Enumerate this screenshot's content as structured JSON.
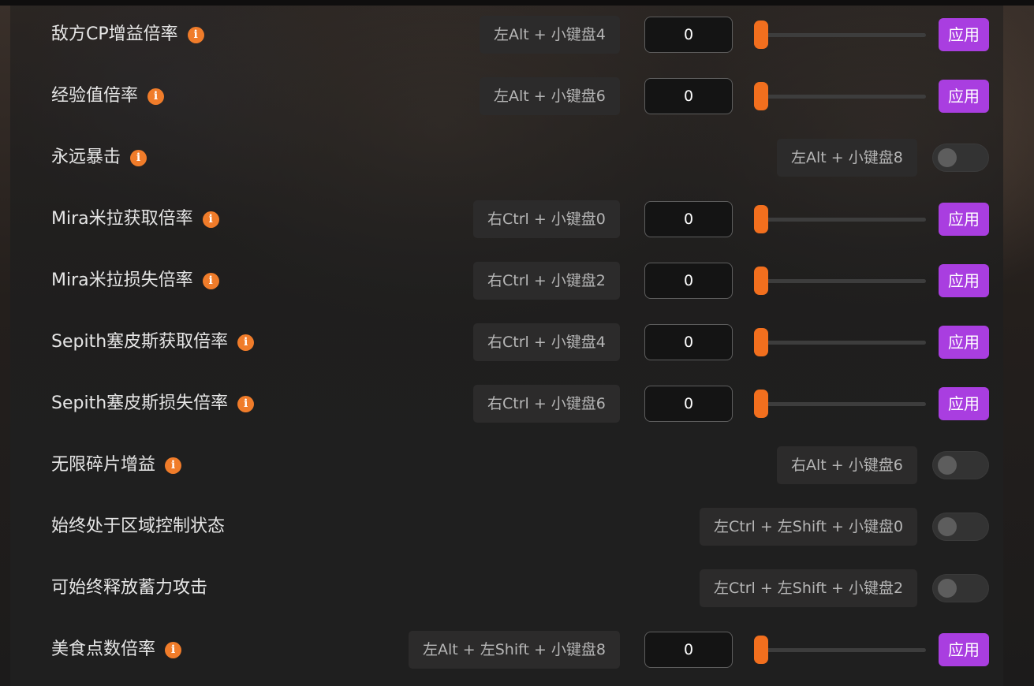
{
  "rows": [
    {
      "label": "敌方CP增益倍率",
      "info": true,
      "hotkey": "左Alt + 小键盘4",
      "type": "slider",
      "value": "0",
      "slider_fraction": 0,
      "apply_label": "应用"
    },
    {
      "label": "经验值倍率",
      "info": true,
      "hotkey": "左Alt + 小键盘6",
      "type": "slider",
      "value": "0",
      "slider_fraction": 0,
      "apply_label": "应用"
    },
    {
      "label": "永远暴击",
      "info": true,
      "hotkey": "左Alt + 小键盘8",
      "type": "toggle",
      "enabled": false
    },
    {
      "label": "Mira米拉获取倍率",
      "info": true,
      "hotkey": "右Ctrl + 小键盘0",
      "type": "slider",
      "value": "0",
      "slider_fraction": 0,
      "apply_label": "应用"
    },
    {
      "label": "Mira米拉损失倍率",
      "info": true,
      "hotkey": "右Ctrl + 小键盘2",
      "type": "slider",
      "value": "0",
      "slider_fraction": 0,
      "apply_label": "应用"
    },
    {
      "label": "Sepith塞皮斯获取倍率",
      "info": true,
      "hotkey": "右Ctrl + 小键盘4",
      "type": "slider",
      "value": "0",
      "slider_fraction": 0,
      "apply_label": "应用"
    },
    {
      "label": "Sepith塞皮斯损失倍率",
      "info": true,
      "hotkey": "右Ctrl + 小键盘6",
      "type": "slider",
      "value": "0",
      "slider_fraction": 0,
      "apply_label": "应用"
    },
    {
      "label": "无限碎片增益",
      "info": true,
      "hotkey": "右Alt + 小键盘6",
      "type": "toggle",
      "enabled": false
    },
    {
      "label": "始终处于区域控制状态",
      "info": false,
      "hotkey": "左Ctrl + 左Shift + 小键盘0",
      "type": "toggle",
      "enabled": false
    },
    {
      "label": "可始终释放蓄力攻击",
      "info": false,
      "hotkey": "左Ctrl + 左Shift + 小键盘2",
      "type": "toggle",
      "enabled": false
    },
    {
      "label": "美食点数倍率",
      "info": true,
      "hotkey": "左Alt + 左Shift + 小键盘8",
      "type": "slider",
      "value": "0",
      "slider_fraction": 0,
      "apply_label": "应用"
    }
  ],
  "info_glyph": "i",
  "icons": {
    "info": "info-circle-icon"
  },
  "colors": {
    "accent_orange": "#f26f1e",
    "apply_purple": "#a93ee0",
    "info_orange": "#f07c2a"
  }
}
